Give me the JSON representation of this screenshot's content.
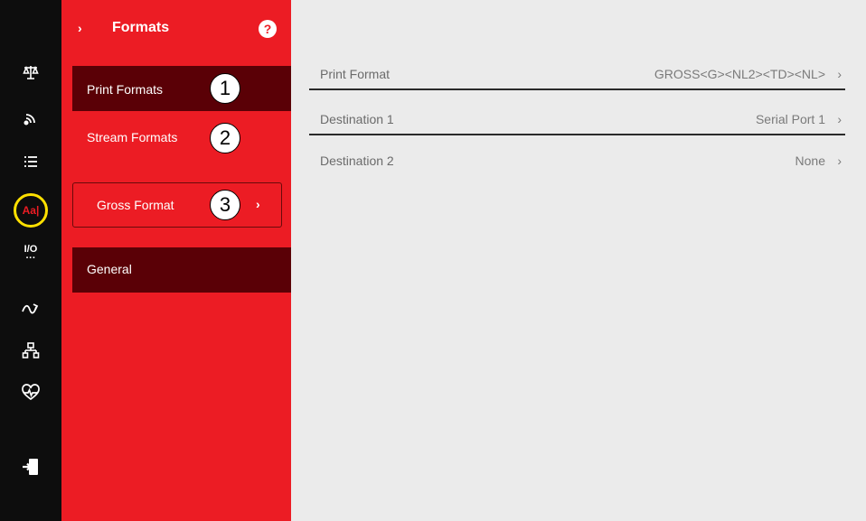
{
  "header": {
    "title": "Formats",
    "expand_glyph": "›",
    "help_glyph": "?"
  },
  "rail_icons": [
    "scale-icon",
    "wireless-icon",
    "list-icon",
    "text-format-icon",
    "io-icon",
    "signal-arrow-icon",
    "network-icon",
    "heart-monitor-icon",
    "logout-icon"
  ],
  "rail_text": {
    "text_format": "Aa|",
    "io": "I/O"
  },
  "nav": {
    "print_formats": "Print Formats",
    "stream_formats": "Stream Formats",
    "gross_format": "Gross Format",
    "gross_chevron": "›",
    "general": "General"
  },
  "badges": [
    "1",
    "2",
    "3"
  ],
  "rows": [
    {
      "label": "Print Format",
      "value": "GROSS<G><NL2><TD><NL>",
      "chevron": "›"
    },
    {
      "label": "Destination 1",
      "value": "Serial Port 1",
      "chevron": "›"
    },
    {
      "label": "Destination 2",
      "value": "None",
      "chevron": "›"
    }
  ],
  "colors": {
    "rail": "#0d0d0d",
    "nav": "#ec1c24",
    "selected": "#5a0006",
    "highlight_ring": "#ffe000",
    "content": "#ebebeb"
  }
}
